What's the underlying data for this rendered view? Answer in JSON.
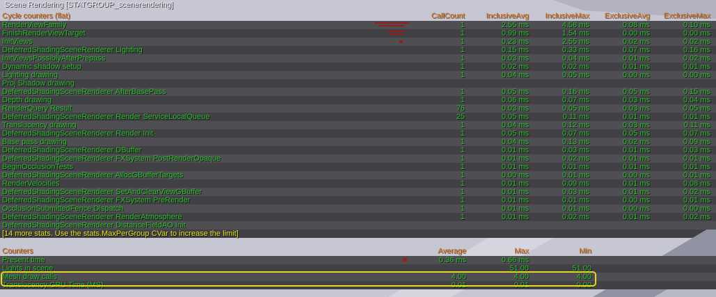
{
  "title": "Scene Rendering [STATGROUP_scenerendering]",
  "colors": {
    "header_orange": "#d9731c",
    "value_green": "#2abe2a",
    "notice_yellow": "#e6e322",
    "highlight_border": "#e9d71e",
    "marker_red": "#8f1f1f",
    "row_dark": "#414145",
    "row_light": "#4f4f53",
    "background": "#c7c7d3"
  },
  "cycle_counters": {
    "section_label": "Cycle counters (flat)",
    "columns": [
      "CallCount",
      "InclusiveAvg",
      "InclusiveMax",
      "ExclusiveAvg",
      "ExclusiveMax"
    ],
    "rows": [
      {
        "name": "RenderViewFamily",
        "call_count": "1",
        "inclusive_avg": "2.55 ms",
        "inclusive_max": "4.58 ms",
        "exclusive_avg": "0.08 ms",
        "exclusive_max": "0.10 ms",
        "marker": "wide"
      },
      {
        "name": "FinishRenderViewTarget",
        "call_count": "1",
        "inclusive_avg": "0.99 ms",
        "inclusive_max": "1.54 ms",
        "exclusive_avg": "0.00 ms",
        "exclusive_max": "0.00 ms",
        "marker": "small"
      },
      {
        "name": "InitViews",
        "call_count": "1",
        "inclusive_avg": "0.23 ms",
        "inclusive_max": "2.55 ms",
        "exclusive_avg": "0.02 ms",
        "exclusive_max": "0.02 ms",
        "marker": "dot"
      },
      {
        "name": "DeferredShadingSceneRenderer Lighting",
        "call_count": "1",
        "inclusive_avg": "0.15 ms",
        "inclusive_max": "0.33 ms",
        "exclusive_avg": "0.07 ms",
        "exclusive_max": "0.16 ms",
        "marker": null
      },
      {
        "name": "InitViewsPossiblyAfterPrepass",
        "call_count": "1",
        "inclusive_avg": "0.03 ms",
        "inclusive_max": "0.04 ms",
        "exclusive_avg": "0.01 ms",
        "exclusive_max": "0.02 ms",
        "marker": null
      },
      {
        "name": "Dynamic shadow setup",
        "call_count": "1",
        "inclusive_avg": "0.02 ms",
        "inclusive_max": "0.02 ms",
        "exclusive_avg": "0.01 ms",
        "exclusive_max": "0.01 ms",
        "marker": null
      },
      {
        "name": "Lighting drawing",
        "call_count": "1",
        "inclusive_avg": "0.04 ms",
        "inclusive_max": "0.05 ms",
        "exclusive_avg": "0.00 ms",
        "exclusive_max": "0.00 ms",
        "marker": null
      },
      {
        "name": "Proj Shadow drawing",
        "call_count": "",
        "inclusive_avg": "",
        "inclusive_max": "",
        "exclusive_avg": "",
        "exclusive_max": "",
        "marker": null
      },
      {
        "name": "DeferredShadingSceneRenderer AfterBasePass",
        "call_count": "1",
        "inclusive_avg": "0.05 ms",
        "inclusive_max": "0.16 ms",
        "exclusive_avg": "0.05 ms",
        "exclusive_max": "0.15 ms",
        "marker": null
      },
      {
        "name": "Depth drawing",
        "call_count": "1",
        "inclusive_avg": "0.06 ms",
        "inclusive_max": "0.07 ms",
        "exclusive_avg": "0.03 ms",
        "exclusive_max": "0.04 ms",
        "marker": null
      },
      {
        "name": "RenderQuery Result",
        "call_count": "76",
        "inclusive_avg": "0.03 ms",
        "inclusive_max": "0.05 ms",
        "exclusive_avg": "0.03 ms",
        "exclusive_max": "0.05 ms",
        "marker": null
      },
      {
        "name": "DeferredShadingSceneRenderer Render ServiceLocalQueue",
        "call_count": "25",
        "inclusive_avg": "0.05 ms",
        "inclusive_max": "0.11 ms",
        "exclusive_avg": "0.01 ms",
        "exclusive_max": "0.01 ms",
        "marker": null
      },
      {
        "name": "Translucency drawing",
        "call_count": "1",
        "inclusive_avg": "0.04 ms",
        "inclusive_max": "0.12 ms",
        "exclusive_avg": "0.03 ms",
        "exclusive_max": "0.11 ms",
        "marker": null
      },
      {
        "name": "DeferredShadingSceneRenderer Render Init",
        "call_count": "1",
        "inclusive_avg": "0.05 ms",
        "inclusive_max": "0.07 ms",
        "exclusive_avg": "0.05 ms",
        "exclusive_max": "0.07 ms",
        "marker": null
      },
      {
        "name": "Base pass drawing",
        "call_count": "1",
        "inclusive_avg": "0.04 ms",
        "inclusive_max": "0.13 ms",
        "exclusive_avg": "0.02 ms",
        "exclusive_max": "0.09 ms",
        "marker": null
      },
      {
        "name": "DeferredShadingSceneRenderer DBuffer",
        "call_count": "1",
        "inclusive_avg": "0.01 ms",
        "inclusive_max": "0.03 ms",
        "exclusive_avg": "0.01 ms",
        "exclusive_max": "0.03 ms",
        "marker": null
      },
      {
        "name": "DeferredShadingSceneRenderer FXSystem PostRenderOpaque",
        "call_count": "1",
        "inclusive_avg": "0.01 ms",
        "inclusive_max": "0.02 ms",
        "exclusive_avg": "0.01 ms",
        "exclusive_max": "0.01 ms",
        "marker": null
      },
      {
        "name": "BeginOcclusionTests",
        "call_count": "1",
        "inclusive_avg": "0.01 ms",
        "inclusive_max": "0.01 ms",
        "exclusive_avg": "0.01 ms",
        "exclusive_max": "0.01 ms",
        "marker": null
      },
      {
        "name": "DeferredShadingSceneRenderer AllocGBufferTargets",
        "call_count": "1",
        "inclusive_avg": "0.00 ms",
        "inclusive_max": "0.01 ms",
        "exclusive_avg": "0.00 ms",
        "exclusive_max": "0.01 ms",
        "marker": null
      },
      {
        "name": "RenderVelocities",
        "call_count": "1",
        "inclusive_avg": "0.01 ms",
        "inclusive_max": "0.09 ms",
        "exclusive_avg": "0.01 ms",
        "exclusive_max": "0.08 ms",
        "marker": null
      },
      {
        "name": "DeferredShadingSceneRenderer SetAndClearViewGBuffer",
        "call_count": "1",
        "inclusive_avg": "0.01 ms",
        "inclusive_max": "0.03 ms",
        "exclusive_avg": "0.01 ms",
        "exclusive_max": "0.02 ms",
        "marker": null
      },
      {
        "name": "DeferredShadingSceneRenderer FXSystem PreRender",
        "call_count": "1",
        "inclusive_avg": "0.01 ms",
        "inclusive_max": "0.01 ms",
        "exclusive_avg": "0.00 ms",
        "exclusive_max": "0.01 ms",
        "marker": null
      },
      {
        "name": "OcclusionSubmittedFence Dispatch",
        "call_count": "1",
        "inclusive_avg": "0.01 ms",
        "inclusive_max": "0.01 ms",
        "exclusive_avg": "0.00 ms",
        "exclusive_max": "0.00 ms",
        "marker": null
      },
      {
        "name": "DeferredShadingSceneRenderer RenderAtmosphere",
        "call_count": "1",
        "inclusive_avg": "0.01 ms",
        "inclusive_max": "0.02 ms",
        "exclusive_avg": "0.01 ms",
        "exclusive_max": "0.02 ms",
        "marker": null
      },
      {
        "name": "DeferredShadingSceneRenderer DistanceFieldAO Init",
        "call_count": "",
        "inclusive_avg": "",
        "inclusive_max": "",
        "exclusive_avg": "",
        "exclusive_max": "",
        "marker": null
      }
    ],
    "overflow_notice": "[14 more stats. Use the stats.MaxPerGroup CVar to increase the limit]"
  },
  "counters": {
    "section_label": "Counters",
    "columns": [
      "Average",
      "Max",
      "Min"
    ],
    "rows": [
      {
        "name": "Present time",
        "average": "0.36 ms",
        "max": "0.66 ms",
        "min": "",
        "marker": "circle",
        "selected": false
      },
      {
        "name": "Lights in scene",
        "average": "",
        "max": "51.00",
        "min": "51.00",
        "marker": null,
        "selected": false
      },
      {
        "name": "Mesh draw calls",
        "average": "4.00",
        "max": "4.00",
        "min": "4.00",
        "marker": null,
        "selected": true
      },
      {
        "name": "Translucency GPU Time (MS)",
        "average": "0.01",
        "max": "0.01",
        "min": "0.00",
        "marker": null,
        "selected": false
      }
    ]
  }
}
